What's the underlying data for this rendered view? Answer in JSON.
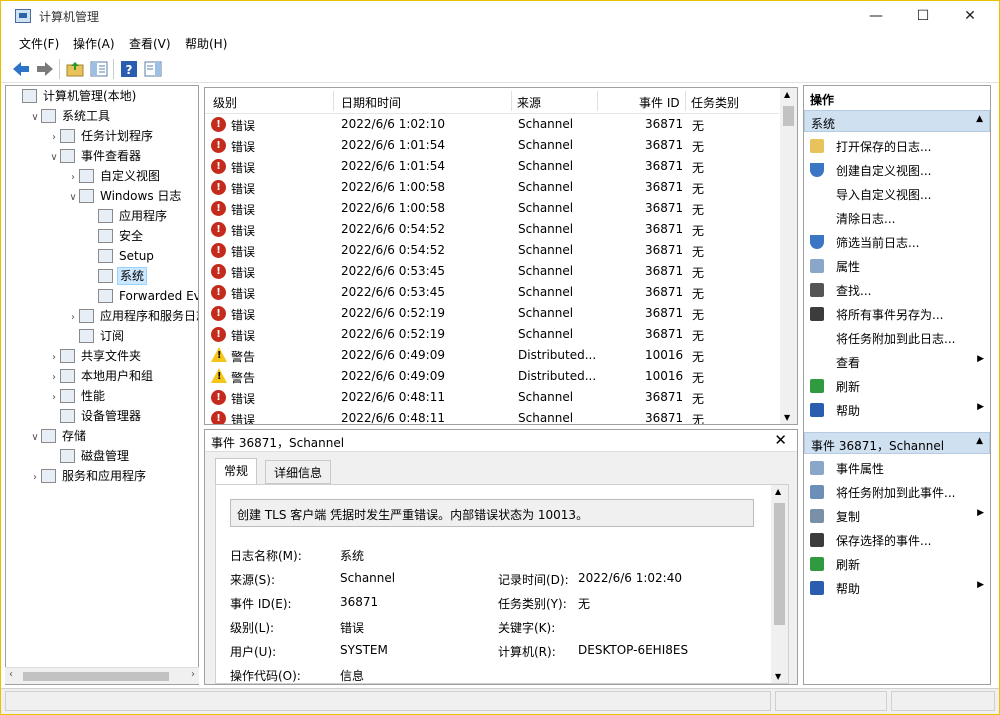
{
  "window": {
    "title": "计算机管理",
    "minimize": "—",
    "maximize": "☐",
    "close": "✕"
  },
  "menu": [
    "文件(F)",
    "操作(A)",
    "查看(V)",
    "帮助(H)"
  ],
  "tree": {
    "items": [
      {
        "label": "计算机管理(本地)",
        "twisty": "",
        "level": 0,
        "icon": "computer-management-icon"
      },
      {
        "label": "系统工具",
        "twisty": "∨",
        "level": 1,
        "icon": "system-tools-icon"
      },
      {
        "label": "任务计划程序",
        "twisty": "›",
        "level": 2,
        "icon": "task-scheduler-icon"
      },
      {
        "label": "事件查看器",
        "twisty": "∨",
        "level": 2,
        "icon": "event-viewer-icon"
      },
      {
        "label": "自定义视图",
        "twisty": "›",
        "level": 3,
        "icon": "custom-views-folder-icon"
      },
      {
        "label": "Windows 日志",
        "twisty": "∨",
        "level": 3,
        "icon": "windows-logs-folder-icon"
      },
      {
        "label": "应用程序",
        "twisty": "",
        "level": 4,
        "icon": "log-icon"
      },
      {
        "label": "安全",
        "twisty": "",
        "level": 4,
        "icon": "log-icon"
      },
      {
        "label": "Setup",
        "twisty": "",
        "level": 4,
        "icon": "log-icon"
      },
      {
        "label": "系统",
        "twisty": "",
        "level": 4,
        "icon": "log-icon",
        "selected": true
      },
      {
        "label": "Forwarded Eve",
        "twisty": "",
        "level": 4,
        "icon": "log-icon"
      },
      {
        "label": "应用程序和服务日志",
        "twisty": "›",
        "level": 3,
        "icon": "app-service-logs-folder-icon"
      },
      {
        "label": "订阅",
        "twisty": "",
        "level": 3,
        "icon": "subscriptions-icon"
      },
      {
        "label": "共享文件夹",
        "twisty": "›",
        "level": 2,
        "icon": "shared-folders-icon"
      },
      {
        "label": "本地用户和组",
        "twisty": "›",
        "level": 2,
        "icon": "local-users-icon"
      },
      {
        "label": "性能",
        "twisty": "›",
        "level": 2,
        "icon": "performance-icon"
      },
      {
        "label": "设备管理器",
        "twisty": "",
        "level": 2,
        "icon": "device-manager-icon"
      },
      {
        "label": "存储",
        "twisty": "∨",
        "level": 1,
        "icon": "storage-icon"
      },
      {
        "label": "磁盘管理",
        "twisty": "",
        "level": 2,
        "icon": "disk-management-icon"
      },
      {
        "label": "服务和应用程序",
        "twisty": "›",
        "level": 1,
        "icon": "services-apps-icon"
      }
    ]
  },
  "events": {
    "columns": [
      "级别",
      "日期和时间",
      "来源",
      "事件 ID",
      "任务类别"
    ],
    "rows": [
      {
        "level": "错误",
        "type": "error",
        "datetime": "2022/6/6 1:02:10",
        "source": "Schannel",
        "id": "36871",
        "category": "无"
      },
      {
        "level": "错误",
        "type": "error",
        "datetime": "2022/6/6 1:01:54",
        "source": "Schannel",
        "id": "36871",
        "category": "无"
      },
      {
        "level": "错误",
        "type": "error",
        "datetime": "2022/6/6 1:01:54",
        "source": "Schannel",
        "id": "36871",
        "category": "无"
      },
      {
        "level": "错误",
        "type": "error",
        "datetime": "2022/6/6 1:00:58",
        "source": "Schannel",
        "id": "36871",
        "category": "无"
      },
      {
        "level": "错误",
        "type": "error",
        "datetime": "2022/6/6 1:00:58",
        "source": "Schannel",
        "id": "36871",
        "category": "无"
      },
      {
        "level": "错误",
        "type": "error",
        "datetime": "2022/6/6 0:54:52",
        "source": "Schannel",
        "id": "36871",
        "category": "无"
      },
      {
        "level": "错误",
        "type": "error",
        "datetime": "2022/6/6 0:54:52",
        "source": "Schannel",
        "id": "36871",
        "category": "无"
      },
      {
        "level": "错误",
        "type": "error",
        "datetime": "2022/6/6 0:53:45",
        "source": "Schannel",
        "id": "36871",
        "category": "无"
      },
      {
        "level": "错误",
        "type": "error",
        "datetime": "2022/6/6 0:53:45",
        "source": "Schannel",
        "id": "36871",
        "category": "无"
      },
      {
        "level": "错误",
        "type": "error",
        "datetime": "2022/6/6 0:52:19",
        "source": "Schannel",
        "id": "36871",
        "category": "无"
      },
      {
        "level": "错误",
        "type": "error",
        "datetime": "2022/6/6 0:52:19",
        "source": "Schannel",
        "id": "36871",
        "category": "无"
      },
      {
        "level": "警告",
        "type": "warning",
        "datetime": "2022/6/6 0:49:09",
        "source": "Distributed...",
        "id": "10016",
        "category": "无"
      },
      {
        "level": "警告",
        "type": "warning",
        "datetime": "2022/6/6 0:49:09",
        "source": "Distributed...",
        "id": "10016",
        "category": "无"
      },
      {
        "level": "错误",
        "type": "error",
        "datetime": "2022/6/6 0:48:11",
        "source": "Schannel",
        "id": "36871",
        "category": "无"
      },
      {
        "level": "错误",
        "type": "error",
        "datetime": "2022/6/6 0:48:11",
        "source": "Schannel",
        "id": "36871",
        "category": "无"
      }
    ]
  },
  "detail": {
    "header": "事件 36871，Schannel",
    "close": "✕",
    "tabs": [
      "常规",
      "详细信息"
    ],
    "description": "创建 TLS 客户端 凭据时发生严重错误。内部错误状态为 10013。",
    "fields": {
      "log_name_label": "日志名称(M):",
      "log_name": "系统",
      "source_label": "来源(S):",
      "source": "Schannel",
      "logged_label": "记录时间(D):",
      "logged": "2022/6/6 1:02:40",
      "event_id_label": "事件 ID(E):",
      "event_id": "36871",
      "task_category_label": "任务类别(Y):",
      "task_category": "无",
      "level_label": "级别(L):",
      "level": "错误",
      "keywords_label": "关键字(K):",
      "keywords": "",
      "user_label": "用户(U):",
      "user": "SYSTEM",
      "computer_label": "计算机(R):",
      "computer": "DESKTOP-6EHI8ES",
      "opcode_label": "操作代码(O):",
      "opcode": "信息"
    }
  },
  "actions": {
    "title": "操作",
    "section1": "系统",
    "items1": [
      {
        "label": "打开保存的日志...",
        "icon": "open-folder-icon",
        "arrow": ""
      },
      {
        "label": "创建自定义视图...",
        "icon": "filter-icon",
        "arrow": ""
      },
      {
        "label": "导入自定义视图...",
        "icon": "",
        "arrow": ""
      },
      {
        "label": "清除日志...",
        "icon": "",
        "arrow": ""
      },
      {
        "label": "筛选当前日志...",
        "icon": "filter-icon",
        "arrow": ""
      },
      {
        "label": "属性",
        "icon": "properties-icon",
        "arrow": ""
      },
      {
        "label": "查找...",
        "icon": "binoculars-icon",
        "arrow": ""
      },
      {
        "label": "将所有事件另存为...",
        "icon": "save-icon",
        "arrow": ""
      },
      {
        "label": "将任务附加到此日志...",
        "icon": "",
        "arrow": ""
      },
      {
        "label": "查看",
        "icon": "",
        "arrow": "▶"
      },
      {
        "label": "刷新",
        "icon": "refresh-icon",
        "arrow": ""
      },
      {
        "label": "帮助",
        "icon": "help-icon",
        "arrow": "▶"
      }
    ],
    "section2": "事件 36871，Schannel",
    "items2": [
      {
        "label": "事件属性",
        "icon": "properties-icon",
        "arrow": ""
      },
      {
        "label": "将任务附加到此事件...",
        "icon": "attach-task-icon",
        "arrow": ""
      },
      {
        "label": "复制",
        "icon": "copy-icon",
        "arrow": "▶"
      },
      {
        "label": "保存选择的事件...",
        "icon": "save-icon",
        "arrow": ""
      },
      {
        "label": "刷新",
        "icon": "refresh-icon",
        "arrow": ""
      },
      {
        "label": "帮助",
        "icon": "help-icon",
        "arrow": "▶"
      }
    ]
  },
  "colors": {
    "error": "#c42b1c",
    "warning": "#f5c518",
    "selection": "#cce8ff",
    "section": "#cfe0f1"
  }
}
